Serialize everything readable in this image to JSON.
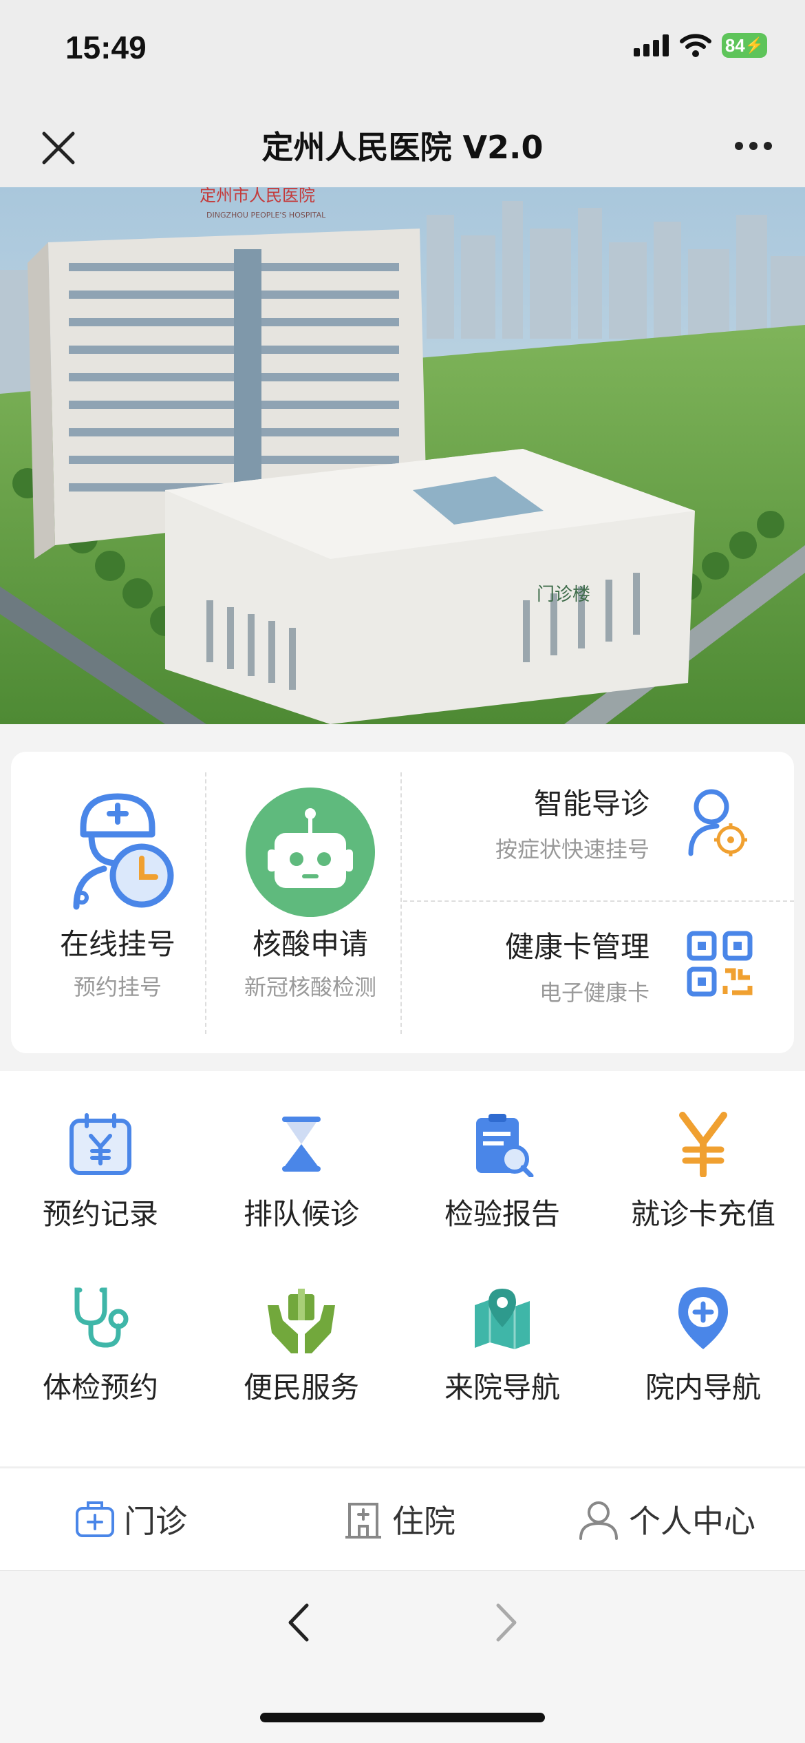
{
  "status_bar": {
    "time": "15:49",
    "battery": "84"
  },
  "nav": {
    "title": "定州人民医院 V2.0"
  },
  "banner": {
    "sign_text": "定州市人民医院",
    "sign_sub": "DINGZHOU PEOPLE'S HOSPITAL",
    "building_sign": "门诊楼"
  },
  "card": {
    "online_register": {
      "title": "在线挂号",
      "subtitle": "预约挂号"
    },
    "nucleic_test": {
      "title": "核酸申请",
      "subtitle": "新冠核酸检测"
    },
    "smart_guide": {
      "title": "智能导诊",
      "subtitle": "按症状快速挂号"
    },
    "health_card": {
      "title": "健康卡管理",
      "subtitle": "电子健康卡"
    }
  },
  "grid": {
    "items": [
      {
        "label": "预约记录",
        "icon": "calendar-yen-icon"
      },
      {
        "label": "排队候诊",
        "icon": "hourglass-icon"
      },
      {
        "label": "检验报告",
        "icon": "report-search-icon"
      },
      {
        "label": "就诊卡充值",
        "icon": "yen-icon"
      },
      {
        "label": "体检预约",
        "icon": "stethoscope-icon"
      },
      {
        "label": "便民服务",
        "icon": "hands-gift-icon"
      },
      {
        "label": "来院导航",
        "icon": "map-pin-icon"
      },
      {
        "label": "院内导航",
        "icon": "location-plus-icon"
      }
    ]
  },
  "tabbar": {
    "outpatient": "门诊",
    "inpatient": "住院",
    "personal": "个人中心"
  },
  "colors": {
    "blue": "#4a86e8",
    "green": "#5fba7d",
    "orange": "#f0a030",
    "teal": "#3fb6a8",
    "olive": "#72a83c"
  }
}
